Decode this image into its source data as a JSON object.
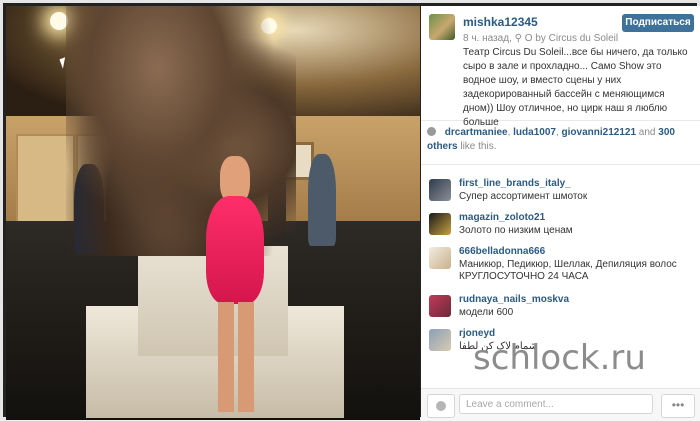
{
  "post": {
    "username": "mishka12345",
    "time": "8 ч. назад",
    "location": "O by Circus du Soleil",
    "meta_separator": "·",
    "follow_label": "Подписаться",
    "caption": "Театр Circus Du Soleil...все бы ничего, да только сыро в зале и прохладно... Само Show это водное шоу, и вместо сцены у них задекорированный бассейн с меняющимся дном)) Шоу отличное, но цирк наш я люблю больше"
  },
  "likes": {
    "users": [
      "drcartmaniee",
      "luda1007",
      "giovanni212121"
    ],
    "and_label": "and",
    "others_label": "300 others",
    "suffix": "like this."
  },
  "comments": [
    {
      "user": "first_line_brands_italy_",
      "text": "Супер ассортимент шмоток"
    },
    {
      "user": "magazin_zoloto21",
      "text": "Золото по низким ценам"
    },
    {
      "user": "666belladonna666",
      "text": "Маникюр, Педикюр, Шеллак, Депиляция волос КРУГЛОСУТОЧНО 24 ЧАСА"
    },
    {
      "user": "rudnaya_nails_moskva",
      "text": "модели 600"
    },
    {
      "user": "rjoneyd",
      "text": "شمام لاک کن لطفا"
    }
  ],
  "footer": {
    "comment_placeholder": "Leave a comment...",
    "more_label": "•••"
  },
  "watermark": "schlock.ru",
  "colors": {
    "link_blue": "#2b5a83",
    "follow_button": "#3f729b",
    "dress": "#ff2e6a"
  }
}
